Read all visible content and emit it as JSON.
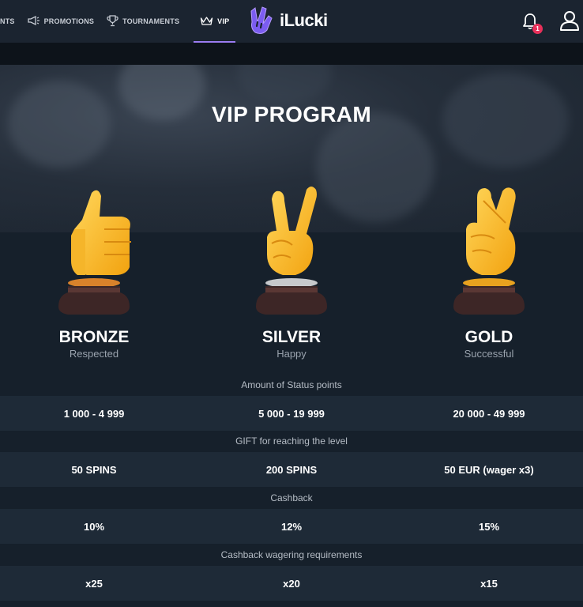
{
  "header": {
    "nav": [
      {
        "label": "NTS",
        "icon": "none"
      },
      {
        "label": "PROMOTIONS",
        "icon": "megaphone-icon"
      },
      {
        "label": "TOURNAMENTS",
        "icon": "trophy-icon"
      },
      {
        "label": "VIP",
        "icon": "crown-icon",
        "active": true
      }
    ],
    "logo_text": "iLucki",
    "notification_count": "1"
  },
  "hero": {
    "title": "VIP PROGRAM"
  },
  "levels": [
    {
      "name": "BRONZE",
      "subtitle": "Respected",
      "gesture": "thumbs-up",
      "plate_color": "#d9822b"
    },
    {
      "name": "SILVER",
      "subtitle": "Happy",
      "gesture": "victory-hand",
      "plate_color": "#c7c9cc"
    },
    {
      "name": "GOLD",
      "subtitle": "Successful",
      "gesture": "crossed-fingers",
      "plate_color": "#e8a21f"
    }
  ],
  "table": [
    {
      "label": "Amount of Status points",
      "values": [
        "1 000 - 4 999",
        "5 000 - 19 999",
        "20 000 - 49 999"
      ]
    },
    {
      "label": "GIFT for reaching the level",
      "values": [
        "50 SPINS",
        "200 SPINS",
        "50 EUR (wager x3)"
      ]
    },
    {
      "label": "Cashback",
      "values": [
        "10%",
        "12%",
        "15%"
      ]
    },
    {
      "label": "Cashback wagering requirements",
      "values": [
        "x25",
        "x20",
        "x15"
      ]
    }
  ],
  "colors": {
    "accent": "#9b7cf1",
    "badge": "#e8305a",
    "row_bg": "#1e2a37",
    "page_bg": "#16202b"
  }
}
